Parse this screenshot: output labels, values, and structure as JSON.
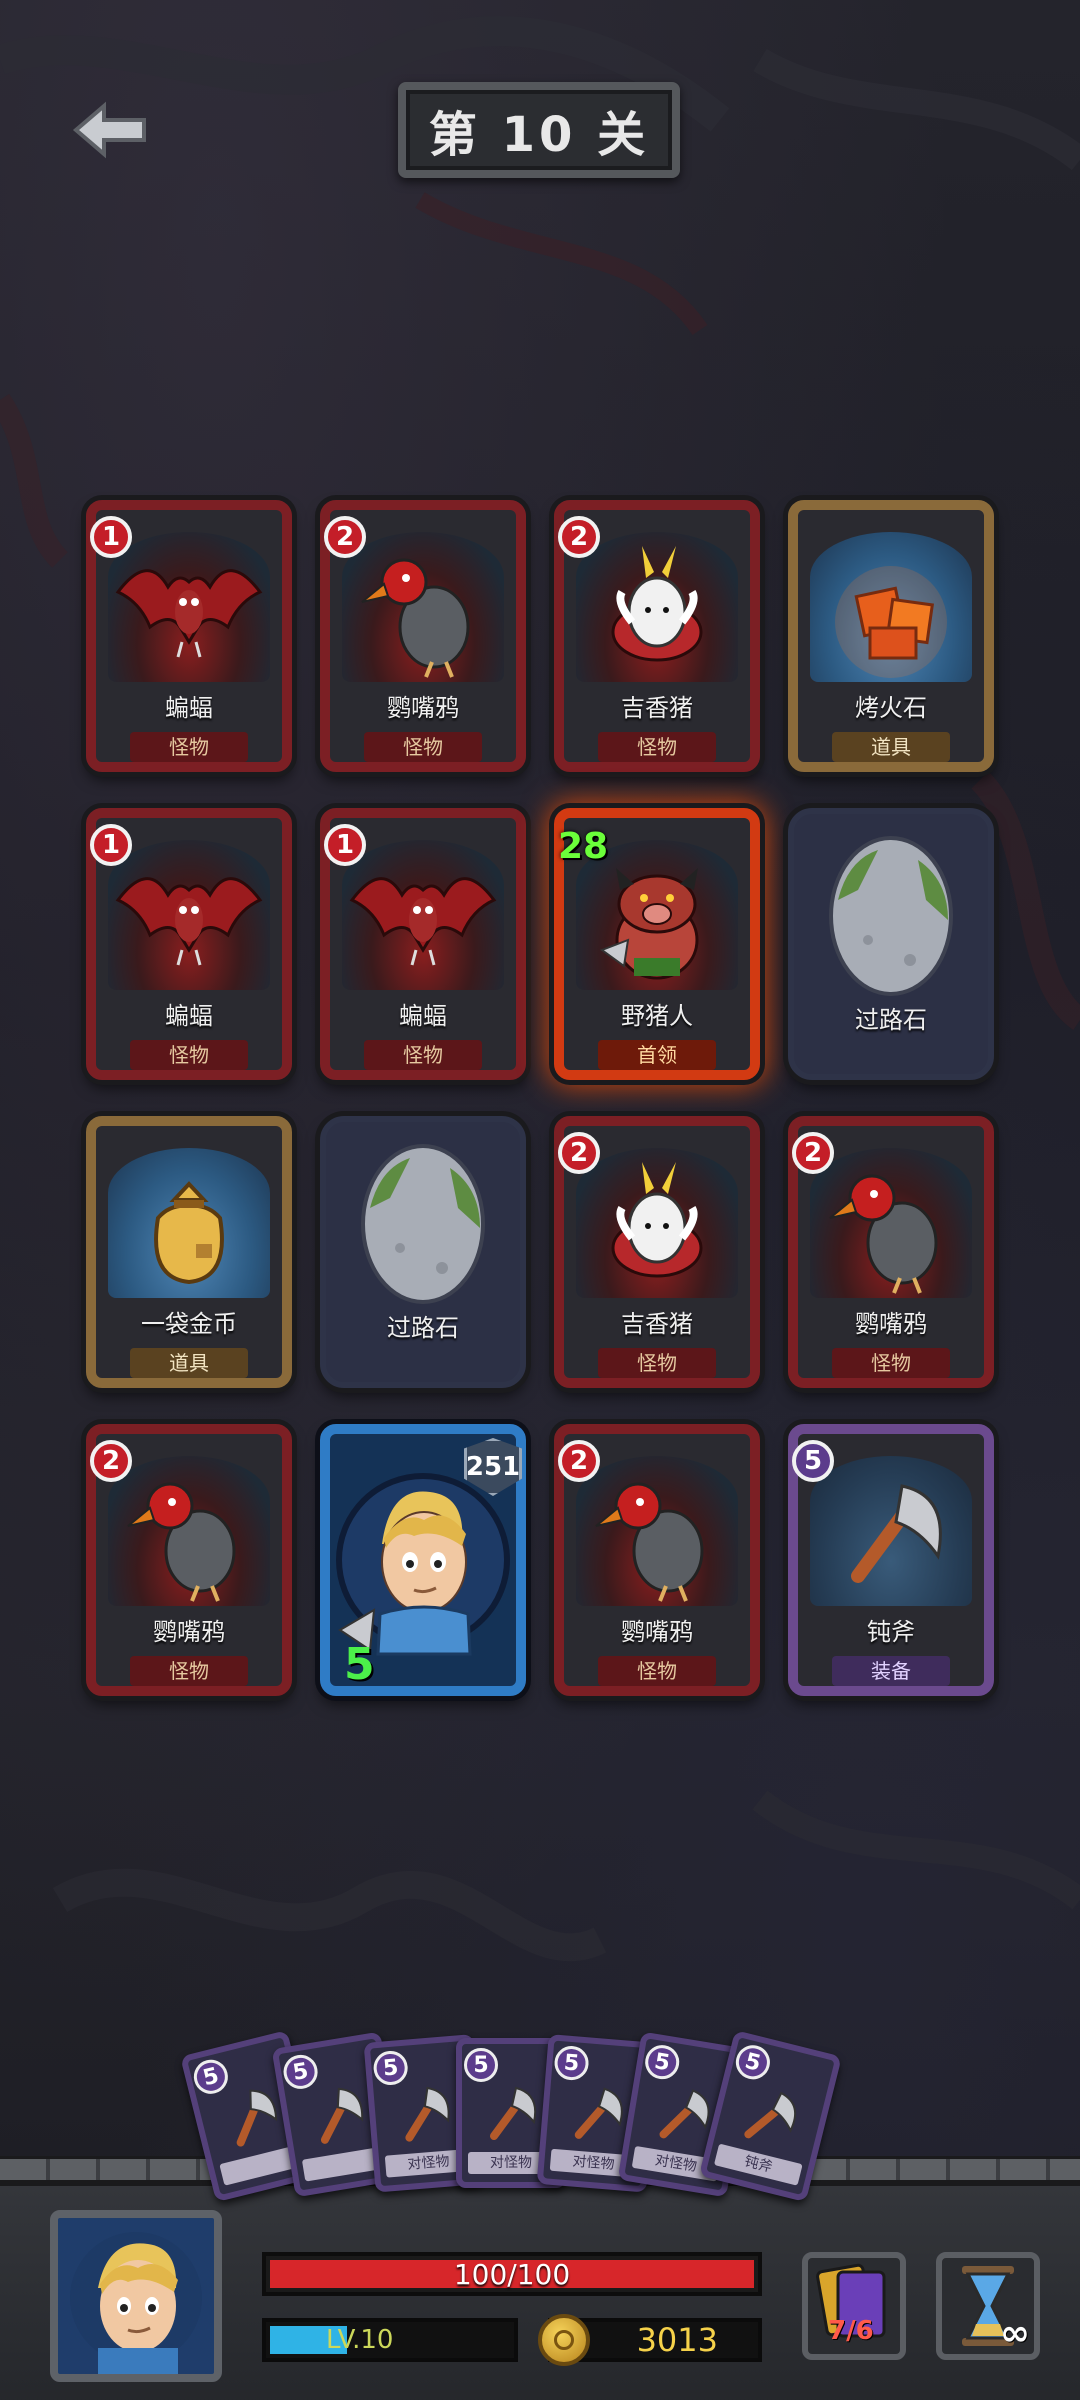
{
  "header": {
    "level_title": "第 10 关",
    "back": "back-arrow-icon"
  },
  "grid": [
    {
      "kind": "monster",
      "cost": "1",
      "name": "蝙蝠",
      "type": "怪物",
      "art": "bat"
    },
    {
      "kind": "monster",
      "cost": "2",
      "name": "鹦嘴鸦",
      "type": "怪物",
      "art": "crow"
    },
    {
      "kind": "monster",
      "cost": "2",
      "name": "吉香猪",
      "type": "怪物",
      "art": "pig"
    },
    {
      "kind": "item",
      "cost": "",
      "name": "烤火石",
      "type": "道具",
      "art": "firestone"
    },
    {
      "kind": "monster",
      "cost": "1",
      "name": "蝙蝠",
      "type": "怪物",
      "art": "bat"
    },
    {
      "kind": "monster",
      "cost": "1",
      "name": "蝙蝠",
      "type": "怪物",
      "art": "bat"
    },
    {
      "kind": "boss",
      "cost": "28",
      "name": "野猪人",
      "type": "首领",
      "art": "boarman"
    },
    {
      "kind": "stone",
      "cost": "",
      "name": "过路石",
      "type": "",
      "art": "stone"
    },
    {
      "kind": "item",
      "cost": "",
      "name": "一袋金币",
      "type": "道具",
      "art": "goldbag"
    },
    {
      "kind": "stone",
      "cost": "",
      "name": "过路石",
      "type": "",
      "art": "stone"
    },
    {
      "kind": "monster",
      "cost": "2",
      "name": "吉香猪",
      "type": "怪物",
      "art": "pig"
    },
    {
      "kind": "monster",
      "cost": "2",
      "name": "鹦嘴鸦",
      "type": "怪物",
      "art": "crow"
    },
    {
      "kind": "monster",
      "cost": "2",
      "name": "鹦嘴鸦",
      "type": "怪物",
      "art": "crow"
    },
    {
      "kind": "hero",
      "hp": "251",
      "atk": "5",
      "art": "hero"
    },
    {
      "kind": "monster",
      "cost": "2",
      "name": "鹦嘴鸦",
      "type": "怪物",
      "art": "crow"
    },
    {
      "kind": "equip",
      "cost": "5",
      "name": "钝斧",
      "type": "装备",
      "art": "axe"
    }
  ],
  "hand": {
    "cards": [
      {
        "cost": "5",
        "label": ""
      },
      {
        "cost": "5",
        "label": ""
      },
      {
        "cost": "5",
        "label": "对怪物"
      },
      {
        "cost": "5",
        "label": "对怪物"
      },
      {
        "cost": "5",
        "label": "对怪物"
      },
      {
        "cost": "5",
        "label": "对怪物"
      },
      {
        "cost": "5",
        "label": "钝斧"
      }
    ]
  },
  "hud": {
    "hp_text": "100/100",
    "hp_fraction": 1.0,
    "level_text": "LV.10",
    "xp_fraction": 0.32,
    "gold": "3013",
    "deck_count": "7/6",
    "time_symbol": "∞"
  },
  "colors": {
    "hp": "#d7262a",
    "xp": "#2fb3e6",
    "gold": "#f6d24a",
    "monster_border": "#7c1f24",
    "item_border": "#8a6a3a",
    "equip_border": "#6b4a8e",
    "hero_border": "#2f7cc6"
  }
}
